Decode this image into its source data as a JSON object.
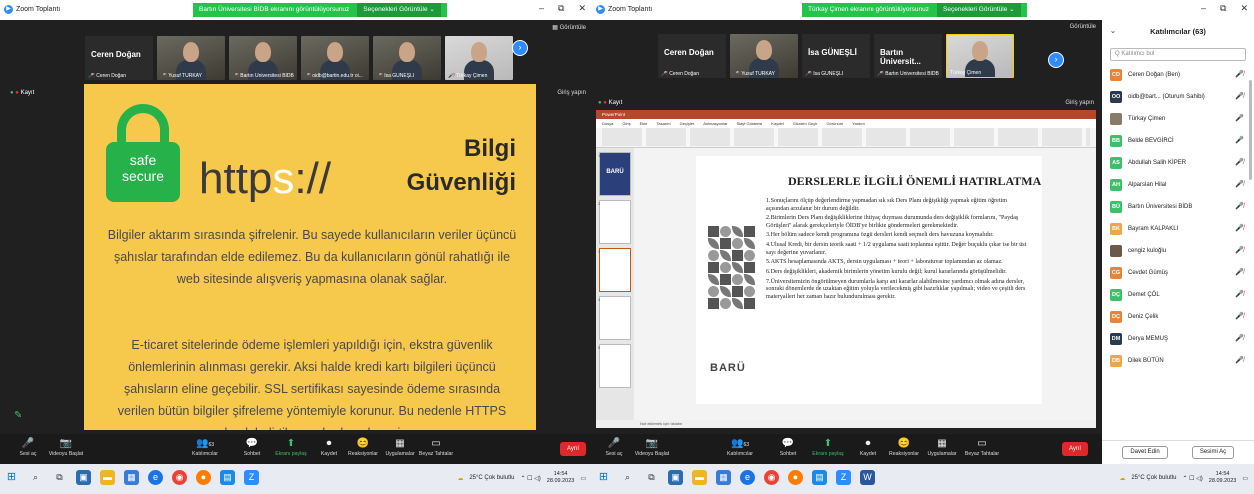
{
  "left": {
    "window_title": "Zoom Toplantı",
    "share_banner": "Bartın Üniversitesi BİDB ekranını görüntülüyorsunuz",
    "share_options": "Seçenekleri Görüntüle",
    "view_label": "Görüntüle",
    "recording_label": "Kayıt",
    "exit_fullscreen": "Giriş yapın",
    "speaker_name": "Ceren Doğan",
    "tiles": [
      {
        "name": "Ceren Doğan",
        "muted": true
      },
      {
        "name": "Yusuf TÜRKAY",
        "muted": true
      },
      {
        "name": "Bartın Üniversitesi BİDB",
        "muted": true
      },
      {
        "name": "oidb@bartin.edu.tr oi...",
        "muted": true
      },
      {
        "name": "İsa GÜNEŞLİ",
        "muted": true
      },
      {
        "name": "Türkay Çimen",
        "muted": true
      }
    ],
    "slide": {
      "lock_top": "safe",
      "lock_bottom": "secure",
      "https_black": "http",
      "https_white": "s",
      "https_tail": "://",
      "title_line1": "Bilgi",
      "title_line2": "Güvenliği",
      "para1": "Bilgiler aktarım sırasında şifrelenir. Bu sayede kullanıcıların veriler üçüncü şahıslar tarafından elde edilemez. Bu da kullanıcıların gönül rahatlığı ile web sitesinde alışveriş yapmasına olanak sağlar.",
      "para2": "E-ticaret sitelerinde ödeme işlemleri yapıldığı için, ekstra güvenlik önlemlerinin alınması gerekir. Aksi halde kredi kartı bilgileri üçüncü şahısların eline geçebilir. SSL sertifikası sayesinde ödeme sırasında verilen bütün bilgiler şifreleme yöntemiyle korunur. Bu nedenle HTTPS olarak belirtilen yerlerden alışveriş"
    },
    "toolbar": [
      {
        "icon": "🎤",
        "label": "Sesi aç"
      },
      {
        "icon": "📷",
        "label": "Videoyu Başlat"
      },
      {
        "icon": "👥",
        "label": "Katılımcılar",
        "count": "63"
      },
      {
        "icon": "💬",
        "label": "Sohbet"
      },
      {
        "icon": "⬆",
        "label": "Ekranı paylaş"
      },
      {
        "icon": "⏺",
        "label": "Kaydet"
      },
      {
        "icon": "😊",
        "label": "Reaksiyonlar"
      },
      {
        "icon": "▦",
        "label": "Uygulamalar"
      },
      {
        "icon": "▭",
        "label": "Beyaz Tahtalar"
      }
    ],
    "end_label": "Ayrıl",
    "weather": "25°C Çok bulutlu",
    "time": "14:54",
    "date": "28.09.2023"
  },
  "right": {
    "window_title": "Zoom Toplantı",
    "share_banner": "Türkay Çimen ekranını görüntülüyorsunuz",
    "share_options": "Seçenekleri Görüntüle",
    "view_label": "Görüntüle",
    "recording_label": "Kayıt",
    "exit_fullscreen": "Giriş yapın",
    "tiles": [
      {
        "big": "Ceren Doğan",
        "name": "Ceren Doğan"
      },
      {
        "big": "",
        "name": "Yusuf TÜRKAY"
      },
      {
        "big": "İsa GÜNEŞLİ",
        "name": "İsa GÜNEŞLİ"
      },
      {
        "big": "Bartın Üniversit...",
        "name": "Bartın Üniversitesi BİDB"
      },
      {
        "big": "",
        "name": "Türkay Çimen"
      }
    ],
    "ppt": {
      "title": "DERSLERLE İLGİLİ ÖNEMLİ HATIRLATMA",
      "tabs": [
        "Dosya",
        "Giriş",
        "Ekle",
        "Tasarım",
        "Geçişler",
        "Animasyonlar",
        "Slayt Gösterisi",
        "Kaydet",
        "Gözden Geçir",
        "Görünüm",
        "Yardım"
      ],
      "notes": "Not eklemek için tıklatın",
      "logo": "BARÜ",
      "items": [
        "1.Sonuçlarını ölçüp değerlendirme yapmadan sık sık Ders Planı değişikliği yapmak eğitim öğretim açısından arzulanır bir durum değildir.",
        "2.Birimlerin Ders Planı değişikliklerine ihtiyaç duyması durumunda ders değişiklik formlarını, \"Paydaş Görüşleri\" alarak gerekçeleriyle ÖİDB'ye birlikte göndermeleri gerekmektedir.",
        "3.Her bölüm sadece kendi programına özgü dersleri kendi seçmeli ders havuzuna koymalıdır.",
        "4.Ulusal Kredi, bir dersin teorik saati + 1/2 uygulama saati toplanma eşittir. Değer buçuklu çıkar ise bir üst sayı değerine yuvarlanır.",
        "5.AKTS hesaplamasında AKTS, dersin uygulaması + teori + laboratuvar toplamından az olamaz.",
        "6.Ders değişiklikleri, akademik birimlerin yönetim kurulu değil; kurul kararlarında görüşülmelidir.",
        "7.Üniversitemizin öngörülmeyen durumlarla karşı ani kararlar alabilmesine yardımcı olmak adına dersler, sonraki dönemlerde de uzaktan eğitim yoluyla verilecekmiş gibi hazırlıklar yapılmalı; video ve çeşitli ders materyalleri her zaman hazır bulundurulması gerekir."
      ]
    },
    "panel": {
      "title": "Katılımcılar (63)",
      "search_placeholder": "Q Katılımcı bul",
      "participants": [
        {
          "initials": "CD",
          "color": "#e8833a",
          "name": "Ceren Doğan (Ben)",
          "status": "🎤̸"
        },
        {
          "initials": "OO",
          "color": "#2b3a4e",
          "name": "oidb@bart... (Oturum Sahibi)",
          "status": "🎤̸"
        },
        {
          "initials": "",
          "color": "#8a7a6a",
          "name": "Türkay Çimen",
          "status": "🎤"
        },
        {
          "initials": "BB",
          "color": "#3fbf6a",
          "name": "Belde BEVGİRCİ",
          "status": "🎤"
        },
        {
          "initials": "AS",
          "color": "#3fbf6a",
          "name": "Abdullah Salih KİPER",
          "status": "🎤̸"
        },
        {
          "initials": "AH",
          "color": "#3fbf6a",
          "name": "Alparslan Hilal",
          "status": "🎤̸"
        },
        {
          "initials": "BÜ",
          "color": "#3fbf6a",
          "name": "Bartın Üniversitesi BİDB",
          "status": "🎤̸"
        },
        {
          "initials": "BK",
          "color": "#f0a54a",
          "name": "Bayram KALPAKLI",
          "status": "🎤̸"
        },
        {
          "initials": "",
          "color": "#6b5a4a",
          "name": "cengiz kuloğlu",
          "status": "🎤̸"
        },
        {
          "initials": "CG",
          "color": "#e8833a",
          "name": "Cevdet Gümüş",
          "status": "🎤̸"
        },
        {
          "initials": "DÇ",
          "color": "#3fbf6a",
          "name": "Demet ÇÖL",
          "status": "🎤̸"
        },
        {
          "initials": "DÇ",
          "color": "#e8833a",
          "name": "Deniz Çelik",
          "status": "🎤̸"
        },
        {
          "initials": "DM",
          "color": "#2b3a4e",
          "name": "Derya MEMUŞ",
          "status": "🎤̸"
        },
        {
          "initials": "DB",
          "color": "#f0a54a",
          "name": "Dilek BÜTÜN",
          "status": "🎤̸"
        }
      ],
      "invite_label": "Davet Edin",
      "unmute_label": "Sesimi Aç"
    },
    "toolbar": [
      {
        "icon": "🎤",
        "label": "Sesi aç"
      },
      {
        "icon": "📷",
        "label": "Videoyu Başlat"
      },
      {
        "icon": "👥",
        "label": "Katılımcılar",
        "count": "63"
      },
      {
        "icon": "💬",
        "label": "Sohbet"
      },
      {
        "icon": "⬆",
        "label": "Ekranı paylaş"
      },
      {
        "icon": "⏺",
        "label": "Kaydet"
      },
      {
        "icon": "😊",
        "label": "Reaksiyonlar"
      },
      {
        "icon": "▦",
        "label": "Uygulamalar"
      },
      {
        "icon": "▭",
        "label": "Beyaz Tahtalar"
      }
    ],
    "end_label": "Ayrıl",
    "weather": "25°C Çok bulutlu",
    "time": "14:54",
    "date": "28.09.2023"
  },
  "colors": {
    "slide_yellow": "#f6c84c",
    "lock_green": "#26b14a",
    "zoom_blue": "#2d8cff",
    "share_green": "#24c44a",
    "end_red": "#e02828"
  }
}
